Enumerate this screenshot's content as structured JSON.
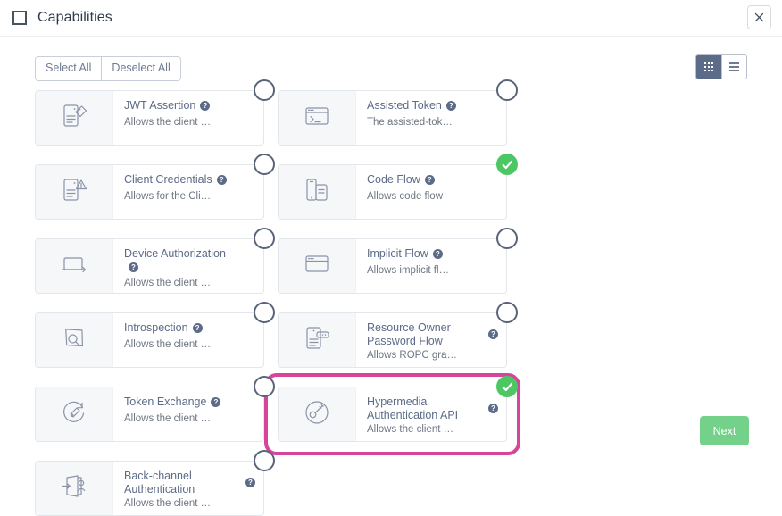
{
  "header": {
    "title": "Capabilities",
    "expand_icon": "expand-icon",
    "close_icon": "close-icon"
  },
  "toolbar": {
    "select_all_label": "Select All",
    "deselect_all_label": "Deselect All",
    "grid_view_icon": "grid-view-icon",
    "list_view_icon": "list-view-icon",
    "active_view": "grid"
  },
  "footer": {
    "next_label": "Next"
  },
  "colors": {
    "selected_green": "#4cc764",
    "next_green": "#74d18a",
    "highlight_pink": "#d6459a",
    "title_slate": "#5c6b87",
    "active_view_bg": "#5c6b87"
  },
  "help_glyph": "?",
  "cards": [
    {
      "title": "JWT Assertion",
      "description": "Allows the client …",
      "icon": "jwt-assertion-icon",
      "selected": false,
      "highlighted": false,
      "two_line": false
    },
    {
      "title": "Assisted Token",
      "description": "The assisted-tok…",
      "icon": "assisted-token-icon",
      "selected": false,
      "highlighted": false,
      "two_line": false
    },
    {
      "title": "Client Credentials",
      "description": "Allows for the Cli…",
      "icon": "client-credentials-icon",
      "selected": false,
      "highlighted": false,
      "two_line": false
    },
    {
      "title": "Code Flow",
      "description": "Allows code flow",
      "icon": "code-flow-icon",
      "selected": true,
      "highlighted": false,
      "two_line": false
    },
    {
      "title": "Device Authorization",
      "description": "Allows the client …",
      "icon": "device-authorization-icon",
      "selected": false,
      "highlighted": false,
      "two_line": false
    },
    {
      "title": "Implicit Flow",
      "description": "Allows implicit fl…",
      "icon": "implicit-flow-icon",
      "selected": false,
      "highlighted": false,
      "two_line": false
    },
    {
      "title": "Introspection",
      "description": "Allows the client …",
      "icon": "introspection-icon",
      "selected": false,
      "highlighted": false,
      "two_line": false
    },
    {
      "title": "Resource Owner Password Flow",
      "description": "Allows ROPC gra…",
      "icon": "resource-owner-password-flow-icon",
      "selected": false,
      "highlighted": false,
      "two_line": true
    },
    {
      "title": "Token Exchange",
      "description": "Allows the client …",
      "icon": "token-exchange-icon",
      "selected": false,
      "highlighted": false,
      "two_line": false
    },
    {
      "title": "Hypermedia Authentication API",
      "description": "Allows the client …",
      "icon": "hypermedia-authentication-api-icon",
      "selected": true,
      "highlighted": true,
      "two_line": true
    },
    {
      "title": "Back-channel Authentication",
      "description": "Allows the client …",
      "icon": "back-channel-authentication-icon",
      "selected": false,
      "highlighted": false,
      "two_line": true
    }
  ]
}
